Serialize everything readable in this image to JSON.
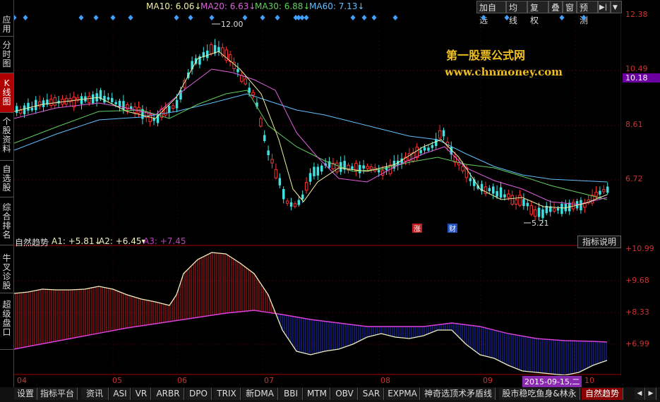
{
  "left_nav": [
    {
      "label": "应用"
    },
    {
      "label": "分时图"
    },
    {
      "label": "K线图"
    },
    {
      "label": "个股资料"
    },
    {
      "label": "自选股"
    },
    {
      "label": "综合排名"
    },
    {
      "label": "牛叉诊股"
    },
    {
      "label": "超级盘口"
    }
  ],
  "legend": {
    "ma10": "MA10: 6.06",
    "ma20": "MA20: 6.63",
    "ma30": "MA30: 6.88",
    "ma60": "MA60: 7.13",
    "colors": {
      "ma10": "#f0f0a0",
      "ma20": "#e060e0",
      "ma30": "#60d060",
      "ma60": "#60c0ff"
    }
  },
  "toolbar": {
    "add_watch": "加自选",
    "line": "均线",
    "restore": "复权",
    "overlay": "叠",
    "window": "窗",
    "forecast": "预测"
  },
  "watermark": {
    "title": "第一股票公式网",
    "url": "www.chnmoney.com"
  },
  "price_axis": [
    "12.38",
    "10.49",
    "10.18",
    "8.61",
    "6.72"
  ],
  "annotations": {
    "high": "12.00",
    "low": "5.21",
    "rise": "涨",
    "fin": "财"
  },
  "indicator": {
    "name": "自然趋势",
    "a1": "A1: +5.81",
    "a2": "A2: +6.45",
    "a3": "A3: +7.45",
    "help": "指标说明",
    "axis": [
      "+10.99",
      "+9.68",
      "+8.33",
      "+6.99"
    ]
  },
  "x_axis": [
    "04",
    "05",
    "06",
    "07",
    "08",
    "09",
    "10"
  ],
  "date_badge": "2015-09-15,二",
  "tabs": [
    "设置",
    "指标平台",
    "资讯",
    "ASI",
    "VR",
    "ARBR",
    "DPO",
    "TRIX",
    "新DMA",
    "BBI",
    "MTM",
    "OBV",
    "SAR",
    "EXPMA",
    "神奇选顶术矛盾线",
    "股市稳吃鱼身&林永",
    "自然趋势"
  ]
}
